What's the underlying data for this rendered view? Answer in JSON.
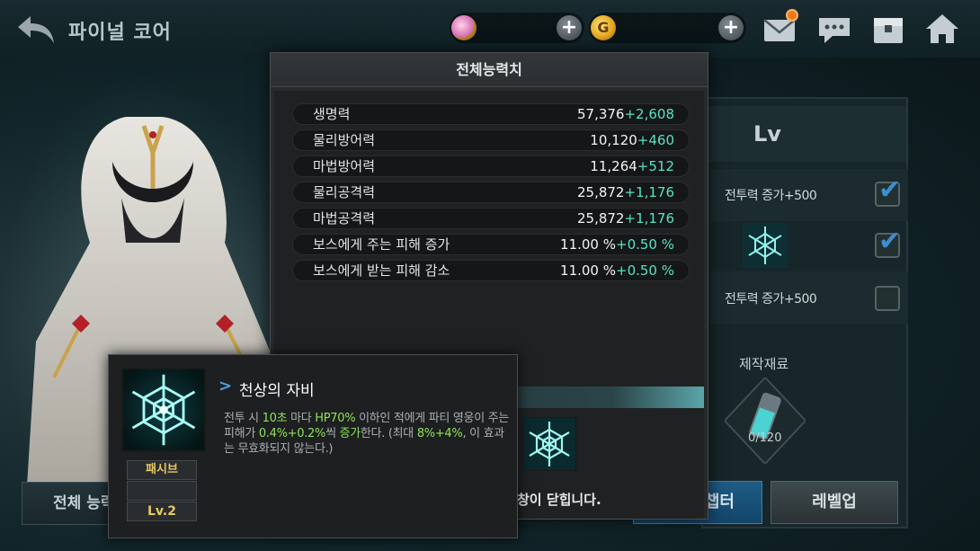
{
  "header": {
    "title": "파이널 코어",
    "currency_a_plus": "+",
    "currency_b_symbol": "G",
    "currency_b_plus": "+"
  },
  "right_panel": {
    "lv_label": "Lv",
    "rows": [
      {
        "label": "전투력 증가+500",
        "checked": true
      },
      {
        "label": "",
        "checked": true
      },
      {
        "label": "전투력 증가+500",
        "checked": false
      }
    ],
    "material_title": "제작재료",
    "material_count": "0/120",
    "chapter_button": "챕터",
    "levelup_button": "레벨업",
    "total_stats_button": "전체 능력"
  },
  "stats_popup": {
    "title": "전체능력치",
    "stats": [
      {
        "name": "생명력",
        "base": "57,376",
        "bonus": "+2,608"
      },
      {
        "name": "물리방어력",
        "base": "10,120",
        "bonus": "+460"
      },
      {
        "name": "마법방어력",
        "base": "11,264",
        "bonus": "+512"
      },
      {
        "name": "물리공격력",
        "base": "25,872",
        "bonus": "+1,176"
      },
      {
        "name": "마법공격력",
        "base": "25,872",
        "bonus": "+1,176"
      },
      {
        "name": "보스에게 주는 피해 증가",
        "base": "11.00 %",
        "bonus": "+0.50 %"
      },
      {
        "name": "보스에게 받는 피해 감소",
        "base": "11.00 %",
        "bonus": "+0.50 %"
      }
    ],
    "close_message": "창이 닫힙니다."
  },
  "skill_tooltip": {
    "name": "천상의 자비",
    "type": "패시브",
    "level": "Lv.2",
    "desc_parts": [
      {
        "t": "전투 시 ",
        "h": false
      },
      {
        "t": "10초",
        "h": true
      },
      {
        "t": " 마다 ",
        "h": false
      },
      {
        "t": "HP70%",
        "h": true
      },
      {
        "t": " 이하인 적에게 파티 영웅이 주는 피해가 ",
        "h": false
      },
      {
        "t": "0.4%",
        "h": true
      },
      {
        "t": "+0.2%",
        "h": true
      },
      {
        "t": "씩 ",
        "h": false
      },
      {
        "t": "증가",
        "h": true
      },
      {
        "t": "한다. (최대 ",
        "h": false
      },
      {
        "t": "8%",
        "h": true
      },
      {
        "t": "+4%",
        "h": true
      },
      {
        "t": ", 이 효과는 무효화되지 않는다.)",
        "h": false
      }
    ]
  },
  "colors": {
    "bonus": "#58e3c4",
    "highlight": "#8ee457",
    "skill_label": "#e8c960",
    "notification": "#f07a1b"
  },
  "icons": [
    "back-arrow-icon",
    "gem-currency-icon",
    "gold-currency-icon",
    "plus-icon",
    "mail-icon",
    "chat-icon",
    "inventory-icon",
    "home-icon",
    "check-icon",
    "snowflake-emblem-icon",
    "potion-material-icon"
  ]
}
